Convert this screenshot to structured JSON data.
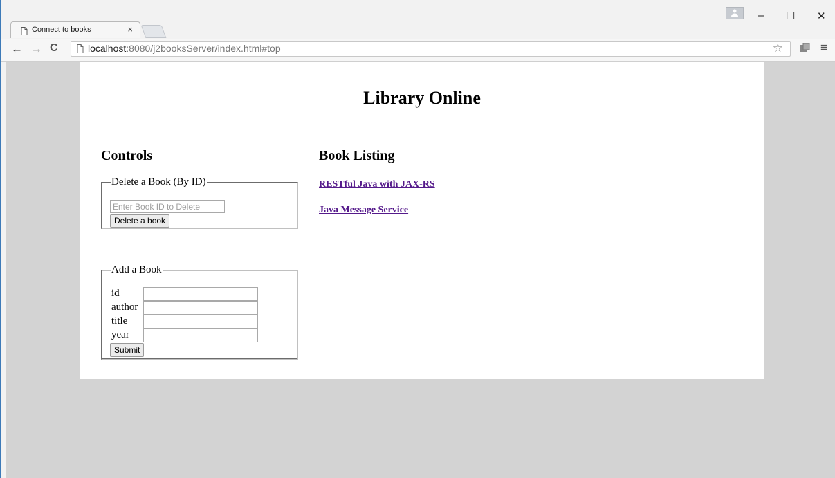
{
  "browser": {
    "tab_title": "Connect to books",
    "tab_close": "×",
    "url_host": "localhost",
    "url_rest": ":8080/j2booksServer/index.html#top",
    "window_controls": {
      "minimize": "–",
      "maximize": "☐",
      "close": "✕"
    }
  },
  "page": {
    "title": "Library Online",
    "controls": {
      "heading": "Controls",
      "delete_section": {
        "legend": "Delete a Book (By ID)",
        "input_placeholder": "Enter Book ID to Delete",
        "button_label": "Delete a book"
      },
      "add_section": {
        "legend": "Add a Book",
        "fields": {
          "id": "id",
          "author": "author",
          "title": "title",
          "year": "year"
        },
        "submit_label": "Submit"
      }
    },
    "listing": {
      "heading": "Book Listing",
      "books": [
        "RESTful Java with JAX-RS",
        "Java Message Service"
      ],
      "link_color": "#551a8b"
    }
  },
  "colors": {
    "viewport_bg": "#d3d3d3",
    "page_bg": "#ffffff"
  }
}
